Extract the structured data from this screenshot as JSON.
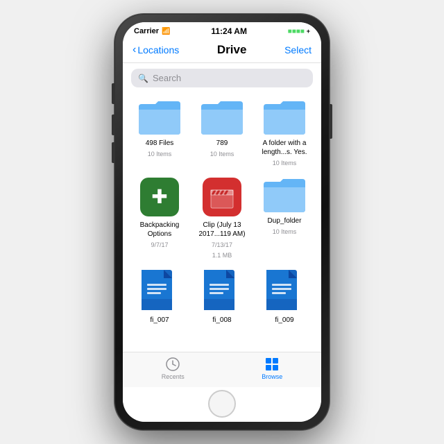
{
  "phone": {
    "statusBar": {
      "carrier": "Carrier",
      "wifi": "▲",
      "time": "11:24 AM",
      "batteryLabel": ""
    },
    "navBar": {
      "backLabel": "Locations",
      "title": "Drive",
      "selectLabel": "Select"
    },
    "search": {
      "placeholder": "Search"
    },
    "grid": {
      "rows": [
        {
          "items": [
            {
              "type": "folder",
              "name": "498 Files",
              "sub": "10 Items"
            },
            {
              "type": "folder",
              "name": "789",
              "sub": "10 Items"
            },
            {
              "type": "folder",
              "name": "A folder with a length...s. Yes.",
              "sub": "10 Items"
            }
          ]
        },
        {
          "items": [
            {
              "type": "app",
              "appType": "backpacking",
              "name": "Backpacking Options",
              "sub": "9/7/17"
            },
            {
              "type": "app",
              "appType": "clip",
              "name": "Clip (July 13 2017...119 AM)",
              "sub": "7/13/17\n1.1 MB"
            },
            {
              "type": "folder",
              "name": "Dup_folder",
              "sub": "10 Items"
            }
          ]
        },
        {
          "items": [
            {
              "type": "doc",
              "name": "fi_007",
              "sub": ""
            },
            {
              "type": "doc",
              "name": "fi_008",
              "sub": ""
            },
            {
              "type": "doc",
              "name": "fi_009",
              "sub": ""
            }
          ]
        }
      ]
    },
    "tabBar": {
      "tabs": [
        {
          "icon": "recents",
          "label": "Recents",
          "active": false
        },
        {
          "icon": "browse",
          "label": "Browse",
          "active": true
        }
      ]
    }
  }
}
